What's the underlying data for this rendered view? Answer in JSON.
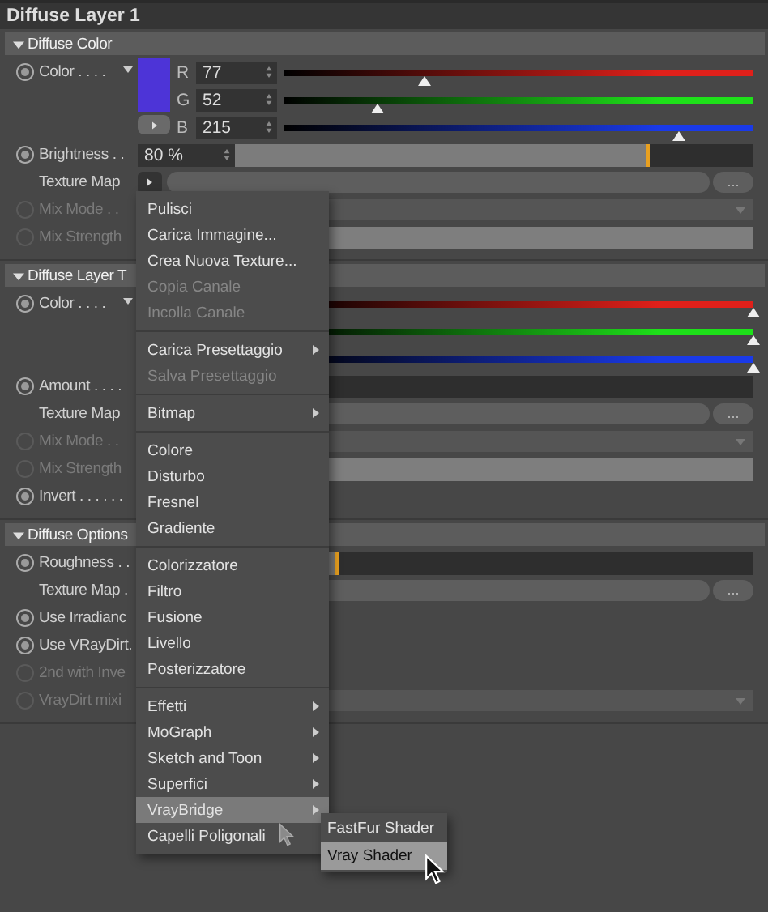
{
  "title": "Diffuse Layer 1",
  "sections": [
    {
      "title": "Diffuse Color",
      "expanded": true,
      "rows": [
        {
          "kind": "color",
          "label": "Color . . . .",
          "disabled": false,
          "swatch": true,
          "channels": [
            {
              "label": "R",
              "value": "77",
              "level": 0.3,
              "color": "#e0201a"
            },
            {
              "label": "G",
              "value": "52",
              "level": 0.2,
              "color": "#1ee01a"
            },
            {
              "label": "B",
              "value": "215",
              "level": 0.84,
              "color": "#1a3ae8"
            }
          ]
        },
        {
          "kind": "slider",
          "label": "Brightness . .",
          "disabled": false,
          "value": "80 %",
          "level": 0.8
        },
        {
          "kind": "texture",
          "label": "Texture Map",
          "more": "...",
          "button": true
        },
        {
          "kind": "dropdown",
          "label": "Mix Mode . .",
          "disabled": true
        },
        {
          "kind": "slider",
          "label": "Mix Strength",
          "disabled": true
        }
      ]
    },
    {
      "title": "Diffuse Layer T",
      "expanded": true,
      "rows": [
        {
          "kind": "color",
          "label": "Color . . . .",
          "disabled": false,
          "channels": [
            {
              "level": 1,
              "color": "#e0201a"
            },
            {
              "level": 1,
              "color": "#1ee01a"
            },
            {
              "level": 1,
              "color": "#1a3ae8"
            }
          ]
        },
        {
          "kind": "slider",
          "label": "Amount . . . .",
          "disabled": false,
          "level": 0
        },
        {
          "kind": "texture",
          "label": "Texture Map",
          "more": "..."
        },
        {
          "kind": "dropdown",
          "label": "Mix Mode . .",
          "disabled": true
        },
        {
          "kind": "slider",
          "label": "Mix Strength",
          "disabled": true
        },
        {
          "kind": "toggle",
          "label": "Invert . . . . . .",
          "disabled": false
        }
      ]
    },
    {
      "title": "Diffuse Options",
      "expanded": true,
      "rows": [
        {
          "kind": "slider",
          "label": "Roughness . .",
          "disabled": false,
          "level": 0.2
        },
        {
          "kind": "texture",
          "label": "Texture Map .",
          "more": "..."
        },
        {
          "kind": "toggle",
          "label": "Use Irradianc",
          "disabled": false
        },
        {
          "kind": "toggle",
          "label": "Use VRayDirt.",
          "disabled": false
        },
        {
          "kind": "toggle",
          "label": "2nd with Inve",
          "disabled": true
        },
        {
          "kind": "dropdown",
          "label": "VrayDirt mixi",
          "disabled": true
        }
      ]
    }
  ],
  "menu": {
    "groups": [
      {
        "items": [
          {
            "label": "Pulisci",
            "disabled": false,
            "submenu": false,
            "selected": false
          },
          {
            "label": "Carica Immagine...",
            "disabled": false,
            "submenu": false,
            "selected": false
          },
          {
            "label": "Crea Nuova Texture...",
            "disabled": false,
            "submenu": false,
            "selected": false
          },
          {
            "label": "Copia Canale",
            "disabled": true,
            "submenu": false,
            "selected": false
          },
          {
            "label": "Incolla Canale",
            "disabled": true,
            "submenu": false,
            "selected": false
          }
        ]
      },
      {
        "items": [
          {
            "label": "Carica Presettaggio",
            "disabled": false,
            "submenu": true,
            "selected": false
          },
          {
            "label": "Salva Presettaggio",
            "disabled": true,
            "submenu": false,
            "selected": false
          }
        ]
      },
      {
        "items": [
          {
            "label": "Bitmap",
            "disabled": false,
            "submenu": true,
            "selected": false
          }
        ]
      },
      {
        "items": [
          {
            "label": "Colore",
            "disabled": false,
            "submenu": false,
            "selected": false
          },
          {
            "label": "Disturbo",
            "disabled": false,
            "submenu": false,
            "selected": false
          },
          {
            "label": "Fresnel",
            "disabled": false,
            "submenu": false,
            "selected": false
          },
          {
            "label": "Gradiente",
            "disabled": false,
            "submenu": false,
            "selected": false
          }
        ]
      },
      {
        "items": [
          {
            "label": "Colorizzatore",
            "disabled": false,
            "submenu": false,
            "selected": false
          },
          {
            "label": "Filtro",
            "disabled": false,
            "submenu": false,
            "selected": false
          },
          {
            "label": "Fusione",
            "disabled": false,
            "submenu": false,
            "selected": false
          },
          {
            "label": "Livello",
            "disabled": false,
            "submenu": false,
            "selected": false
          },
          {
            "label": "Posterizzatore",
            "disabled": false,
            "submenu": false,
            "selected": false
          }
        ]
      },
      {
        "items": [
          {
            "label": "Effetti",
            "disabled": false,
            "submenu": true,
            "selected": false
          },
          {
            "label": "MoGraph",
            "disabled": false,
            "submenu": true,
            "selected": false
          },
          {
            "label": "Sketch and Toon",
            "disabled": false,
            "submenu": true,
            "selected": false
          },
          {
            "label": "Superfici",
            "disabled": false,
            "submenu": true,
            "selected": false
          },
          {
            "label": "VrayBridge",
            "disabled": false,
            "submenu": true,
            "selected": true
          },
          {
            "label": "Capelli Poligonali",
            "disabled": false,
            "submenu": false,
            "selected": false
          }
        ]
      }
    ]
  },
  "submenu": {
    "items": [
      {
        "label": "FastFur Shader",
        "selected": false
      },
      {
        "label": "Vray Shader",
        "selected": true
      }
    ]
  }
}
